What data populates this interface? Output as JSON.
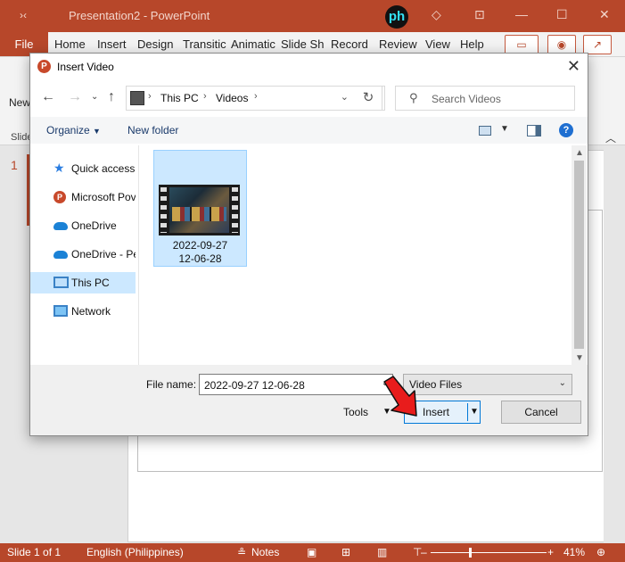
{
  "powerpoint": {
    "title": "Presentation2  -  PowerPoint",
    "quick_access": "›‹",
    "logo_text": "ph",
    "tabs": [
      "File",
      "Home",
      "Insert",
      "Design",
      "Transitic",
      "Animatic",
      "Slide Sh",
      "Record",
      "Review",
      "View",
      "Help"
    ],
    "new_slide_label": "New Slide",
    "slides_group_label": "Slides",
    "slide_number": "1",
    "status": {
      "slide_count": "Slide 1 of 1",
      "language": "English (Philippines)",
      "notes": "Notes",
      "zoom": "41%"
    },
    "accent_color": "#b7472a"
  },
  "dialog": {
    "title": "Insert Video",
    "breadcrumb": [
      "This PC",
      "Videos"
    ],
    "search_placeholder": "Search Videos",
    "commands": {
      "organize": "Organize",
      "new_folder": "New folder"
    },
    "nav_items": [
      {
        "label": "Quick access",
        "icon": "star-icon"
      },
      {
        "label": "Microsoft Pov",
        "icon": "powerpoint-icon"
      },
      {
        "label": "OneDrive",
        "icon": "cloud-icon"
      },
      {
        "label": "OneDrive - Pe",
        "icon": "cloud-icon"
      },
      {
        "label": "This PC",
        "icon": "computer-icon",
        "selected": true
      },
      {
        "label": "Network",
        "icon": "network-icon"
      }
    ],
    "files": [
      {
        "name_line1": "2022-09-27",
        "name_line2": "12-06-28",
        "selected": true
      }
    ],
    "file_name_label": "File name:",
    "file_name_value": "2022-09-27 12-06-28",
    "file_type": "Video Files",
    "tools_label": "Tools",
    "insert_label": "Insert",
    "cancel_label": "Cancel"
  }
}
